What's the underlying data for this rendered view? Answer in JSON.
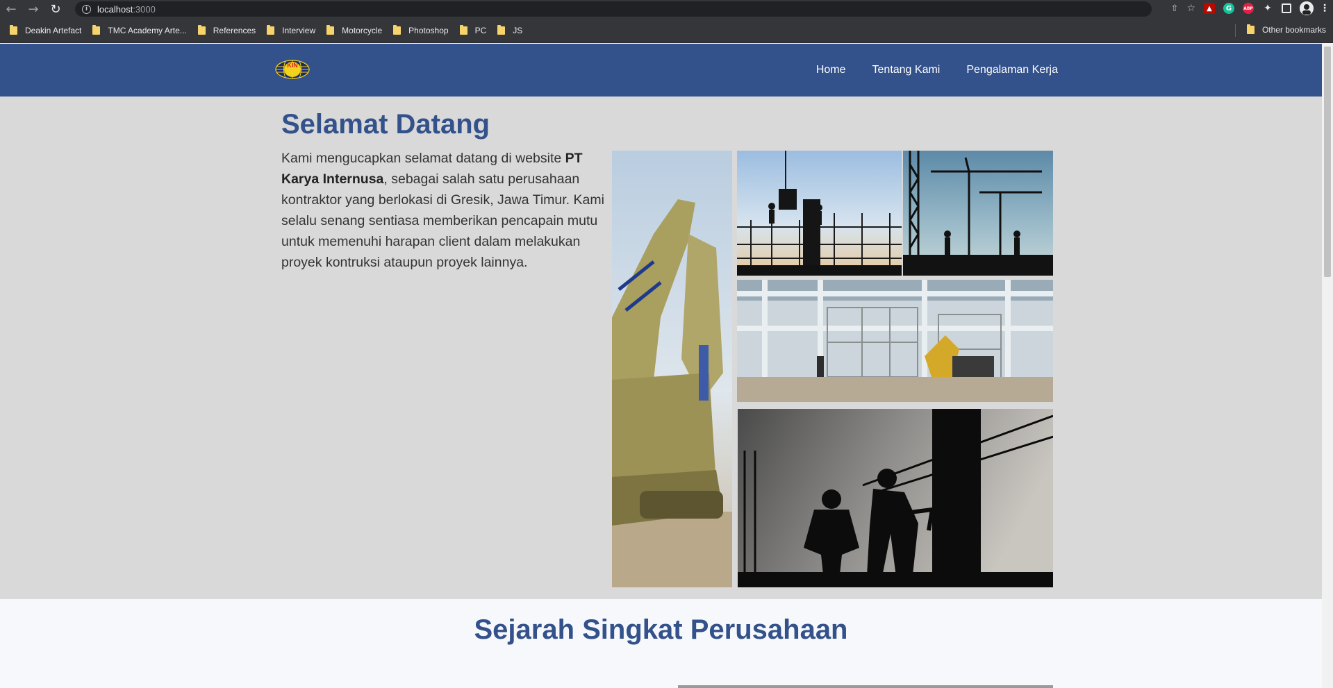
{
  "browser": {
    "url_host": "localhost",
    "url_port": ":3000",
    "bookmarks": [
      "Deakin Artefact",
      "TMC Academy Arte...",
      "References",
      "Interview",
      "Motorcycle",
      "Photoshop",
      "PC",
      "JS"
    ],
    "other_bookmarks": "Other bookmarks",
    "extensions": {
      "abp": "ABP"
    }
  },
  "navbar": {
    "logo_text": "KIN",
    "links": [
      "Home",
      "Tentang Kami",
      "Pengalaman Kerja"
    ],
    "brand_color": "#33518a"
  },
  "hero": {
    "title": "Selamat Datang",
    "text_before": "Kami mengucapkan selamat datang di website ",
    "company": "PT Karya Internusa",
    "text_after": ", sebagai salah satu perusahaan kontraktor yang berlokasi di Gresik, Jawa Timur. Kami selalu senang sentiasa memberikan pencapain mutu untuk memenuhi harapan client dalam melakukan proyek kontruksi ataupun proyek lainnya.",
    "background": "#d9d9d9"
  },
  "section2": {
    "title": "Sejarah Singkat Perusahaan"
  }
}
